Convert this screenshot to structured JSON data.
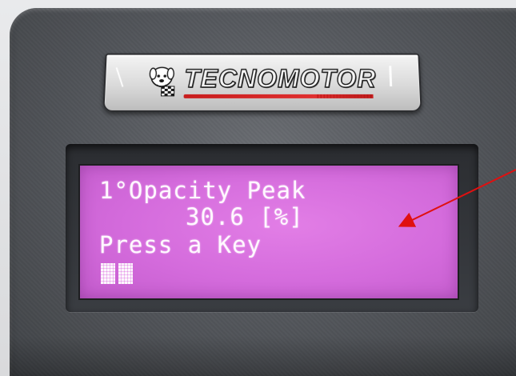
{
  "brand": {
    "logo_text": "TECNOMOTOR",
    "mascot": "dog-mascot-icon"
  },
  "display": {
    "line1": "1°Opacity Peak",
    "line2": "30.6 [%]",
    "line3": "Press a Key",
    "cursor": "block-cursor-icon"
  },
  "colors": {
    "lcd_background": "#d46bdc",
    "lcd_text": "#fff8ff",
    "device_body": "#55585d",
    "logo_accent": "#c81e1e",
    "annotation_arrow": "#e01010"
  }
}
